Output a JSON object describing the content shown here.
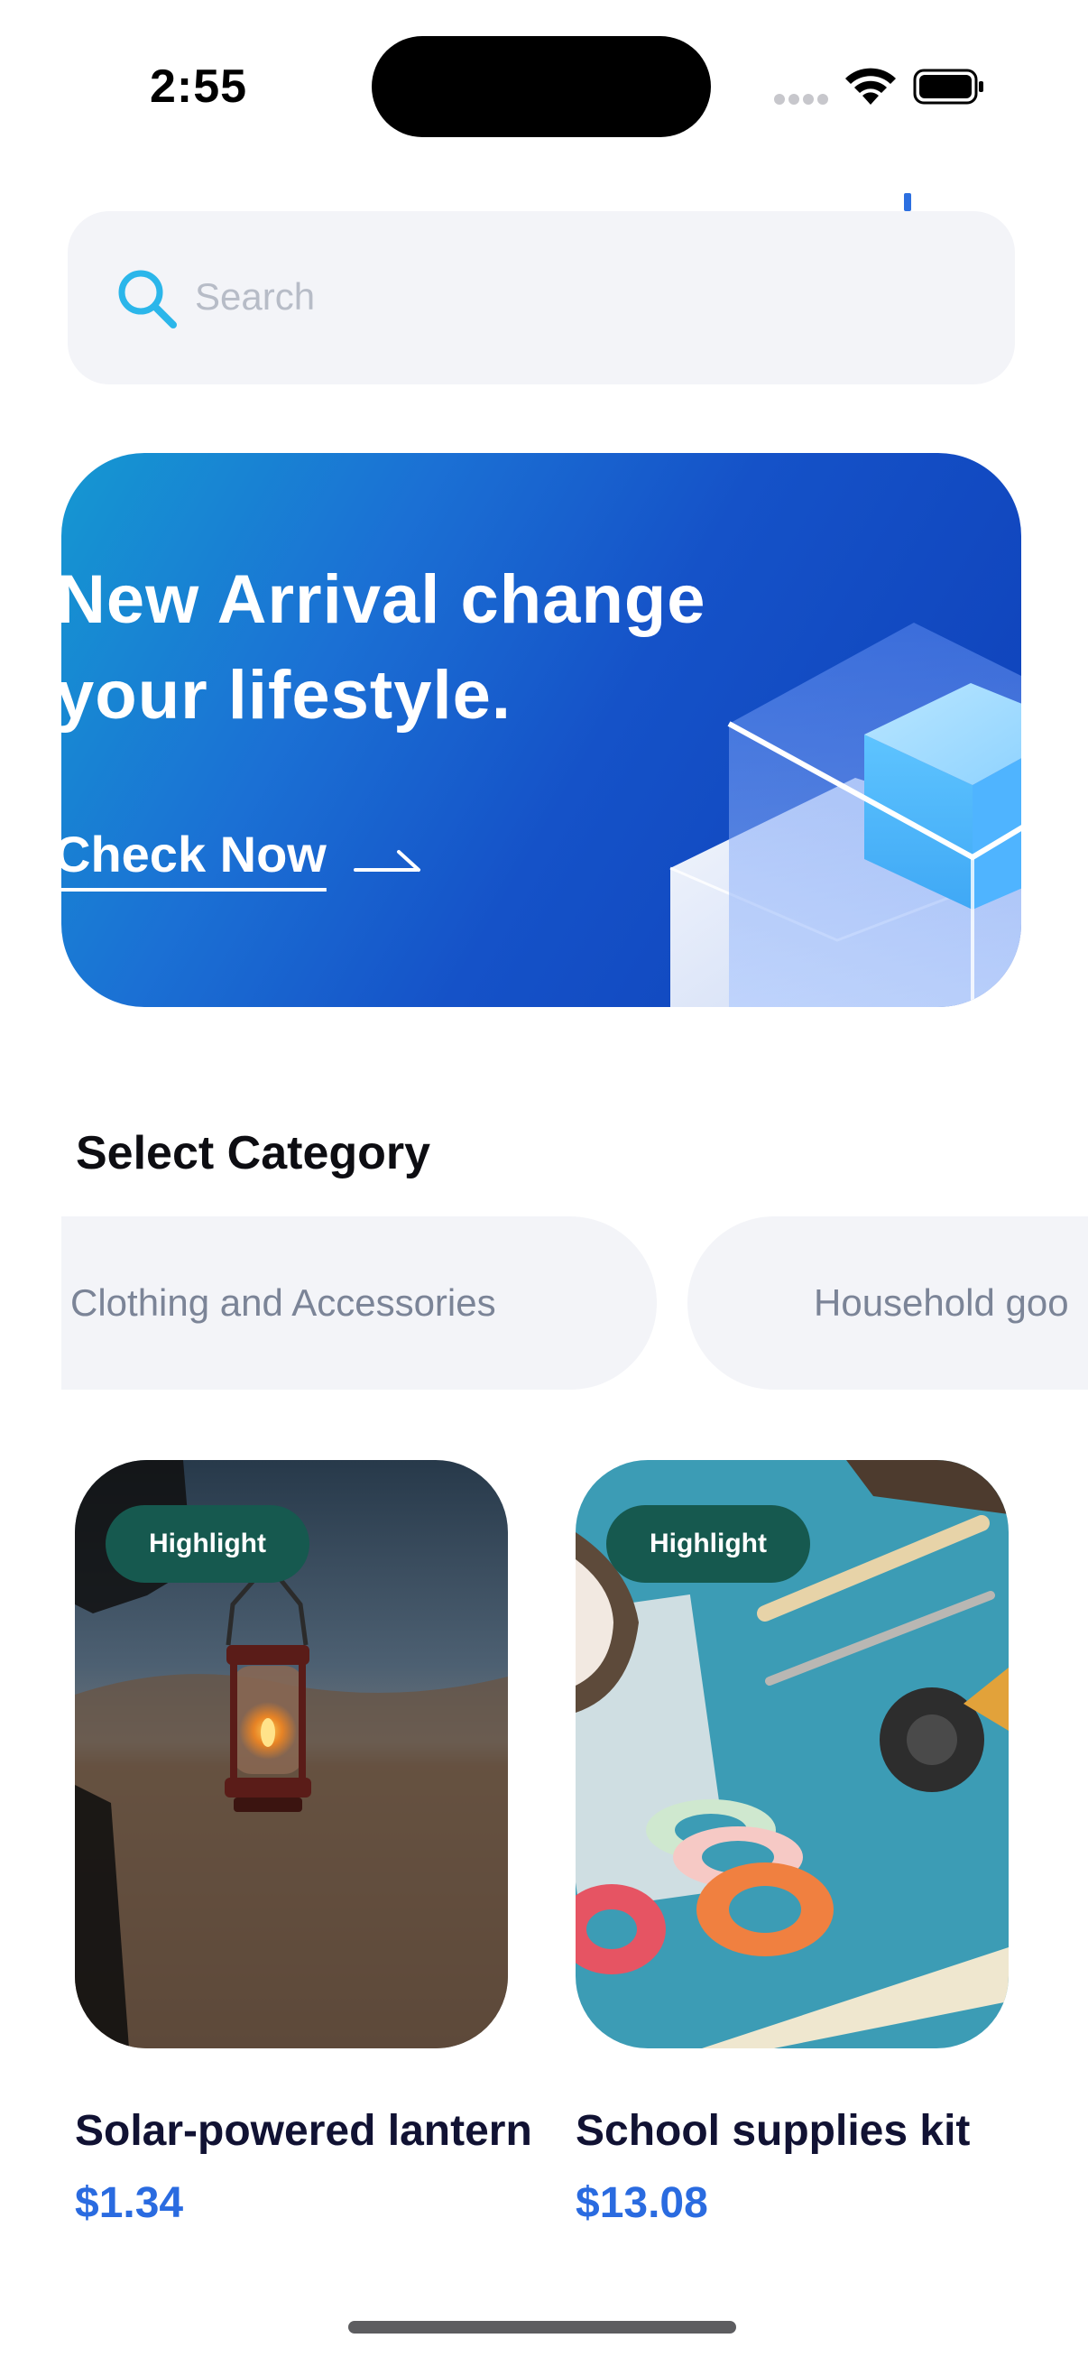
{
  "status_bar": {
    "time": "2:55",
    "icons": [
      "cellular-icon",
      "wifi-icon",
      "battery-icon"
    ]
  },
  "search": {
    "placeholder": "Search",
    "icon": "search-icon",
    "icon_color": "#2bb6ea"
  },
  "banner": {
    "title": "New Arrival change your lifestyle.",
    "cta_label": "Check Now",
    "cta_icon": "arrow-right-icon",
    "gradient_colors": [
      "#1598d2",
      "#1552c8",
      "#0e3fb8"
    ]
  },
  "categories": {
    "title": "Select Category",
    "items": [
      {
        "label": "Clothing and Accessories"
      },
      {
        "label": "Household goo"
      }
    ]
  },
  "products": [
    {
      "badge": "Highlight",
      "name": "Solar-powered lantern",
      "price": "$1.34"
    },
    {
      "badge": "Highlight",
      "name": "School supplies kit",
      "price": "$13.08"
    }
  ],
  "colors": {
    "accent": "#2a6be0",
    "badge_bg": "#16594f",
    "pill_bg": "#f3f4f8",
    "product_name": "#111233"
  }
}
